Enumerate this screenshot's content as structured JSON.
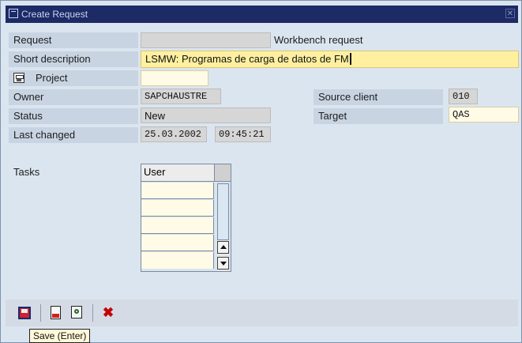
{
  "window": {
    "title": "Create Request",
    "close_label": "✕"
  },
  "form": {
    "request_label": "Request",
    "request_value": "",
    "request_type": "Workbench request",
    "short_description_label": "Short description",
    "short_description_value": "LSMW: Programas de carga de datos de FM",
    "project_label": "Project",
    "project_value": "",
    "owner_label": "Owner",
    "owner_value": "SAPCHAUSTRE",
    "status_label": "Status",
    "status_value": "New",
    "last_changed_label": "Last changed",
    "last_changed_date": "25.03.2002",
    "last_changed_time": "09:45:21",
    "source_client_label": "Source client",
    "source_client_value": "010",
    "target_label": "Target",
    "target_value": "QAS"
  },
  "tasks": {
    "label": "Tasks",
    "column_header": "User",
    "rows": [
      "",
      "",
      "",
      "",
      ""
    ]
  },
  "toolbar": {
    "save_icon": "save-icon",
    "doc_icon": "new-document-icon",
    "lock_icon": "protect-icon",
    "cancel_icon": "cancel-icon",
    "cancel_glyph": "✖"
  },
  "tooltip": {
    "text": "Save  (Enter)"
  }
}
